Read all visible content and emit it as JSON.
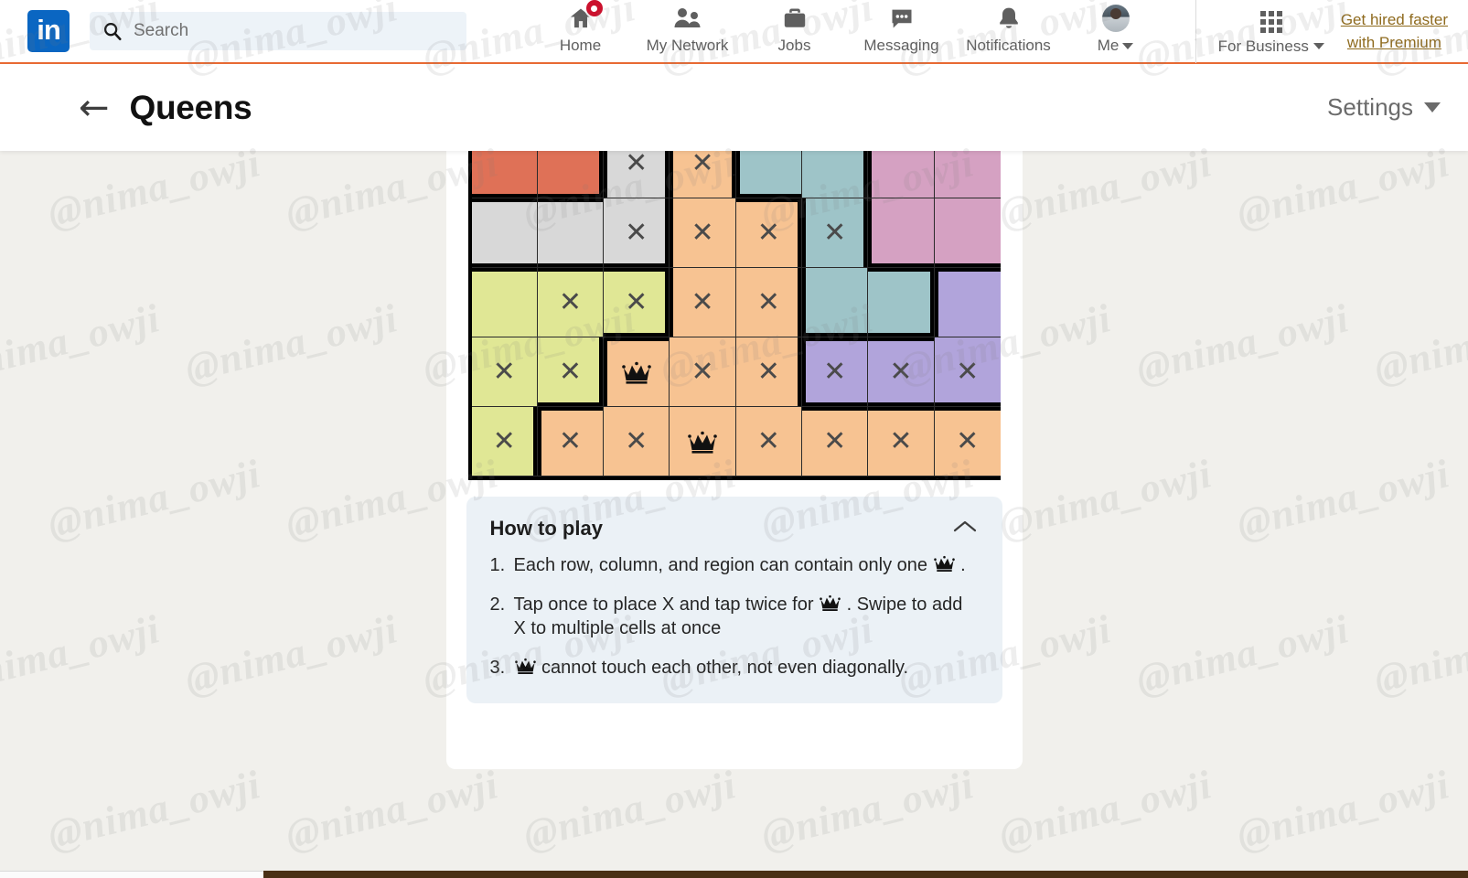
{
  "nav": {
    "logo_text": "in",
    "logo_name": "linkedin-logo",
    "search": {
      "placeholder": "Search",
      "value": "",
      "icon": "search-icon"
    },
    "items": [
      {
        "label": "Home",
        "icon": "home-icon",
        "badge": true
      },
      {
        "label": "My Network",
        "icon": "people-icon",
        "badge": false
      },
      {
        "label": "Jobs",
        "icon": "briefcase-icon",
        "badge": false
      },
      {
        "label": "Messaging",
        "icon": "chat-bubble-icon",
        "badge": false
      },
      {
        "label": "Notifications",
        "icon": "bell-icon",
        "badge": false
      },
      {
        "label": "Me",
        "icon": "avatar-icon",
        "badge": false
      }
    ],
    "for_business": {
      "label": "For Business",
      "icon": "apps-grid-icon"
    },
    "premium": {
      "line1": "Get hired faster",
      "line2": "with Premium"
    }
  },
  "game_header": {
    "back_icon": "back-arrow-icon",
    "title": "Queens",
    "settings_label": "Settings",
    "settings_icon": "chevron-down-icon"
  },
  "board": {
    "columns": 8,
    "rows": 5,
    "colors": {
      "red": "#DF7157",
      "gray": "#D8D8D8",
      "orange": "#F7C392",
      "teal": "#9EC4C8",
      "pink": "#D5A1C2",
      "green": "#E0E795",
      "purple": "#B1A4DB"
    },
    "cells": [
      [
        {
          "color": "red",
          "mark": ""
        },
        {
          "color": "red",
          "mark": ""
        },
        {
          "color": "gray",
          "mark": "x"
        },
        {
          "color": "orange",
          "mark": "x"
        },
        {
          "color": "teal",
          "mark": ""
        },
        {
          "color": "teal",
          "mark": ""
        },
        {
          "color": "pink",
          "mark": ""
        },
        {
          "color": "pink",
          "mark": ""
        }
      ],
      [
        {
          "color": "gray",
          "mark": ""
        },
        {
          "color": "gray",
          "mark": ""
        },
        {
          "color": "gray",
          "mark": "x"
        },
        {
          "color": "orange",
          "mark": "x"
        },
        {
          "color": "orange",
          "mark": "x"
        },
        {
          "color": "teal",
          "mark": "x"
        },
        {
          "color": "pink",
          "mark": ""
        },
        {
          "color": "pink",
          "mark": ""
        }
      ],
      [
        {
          "color": "green",
          "mark": ""
        },
        {
          "color": "green",
          "mark": "x"
        },
        {
          "color": "green",
          "mark": "x"
        },
        {
          "color": "orange",
          "mark": "x"
        },
        {
          "color": "orange",
          "mark": "x"
        },
        {
          "color": "teal",
          "mark": ""
        },
        {
          "color": "teal",
          "mark": ""
        },
        {
          "color": "purple",
          "mark": ""
        }
      ],
      [
        {
          "color": "green",
          "mark": "x"
        },
        {
          "color": "green",
          "mark": "x"
        },
        {
          "color": "orange",
          "mark": "queen"
        },
        {
          "color": "orange",
          "mark": "x"
        },
        {
          "color": "orange",
          "mark": "x"
        },
        {
          "color": "purple",
          "mark": "x"
        },
        {
          "color": "purple",
          "mark": "x"
        },
        {
          "color": "purple",
          "mark": "x"
        }
      ],
      [
        {
          "color": "green",
          "mark": "x"
        },
        {
          "color": "orange",
          "mark": "x"
        },
        {
          "color": "orange",
          "mark": "x"
        },
        {
          "color": "orange",
          "mark": "queen"
        },
        {
          "color": "orange",
          "mark": "x"
        },
        {
          "color": "orange",
          "mark": "x"
        },
        {
          "color": "orange",
          "mark": "x"
        },
        {
          "color": "orange",
          "mark": "x"
        }
      ]
    ]
  },
  "how_to_play": {
    "title": "How to play",
    "collapse_icon": "chevron-up-icon",
    "rules": [
      {
        "num": "1.",
        "pre": "Each row, column, and region can contain only one",
        "post": "."
      },
      {
        "num": "2.",
        "pre": "Tap once to place X and tap twice for",
        "post": ". Swipe to add X to multiple cells at once"
      },
      {
        "num": "3.",
        "pre": "",
        "post": "cannot touch each other, not even diagonally."
      }
    ]
  },
  "watermark": {
    "text": "@nima_owji"
  }
}
